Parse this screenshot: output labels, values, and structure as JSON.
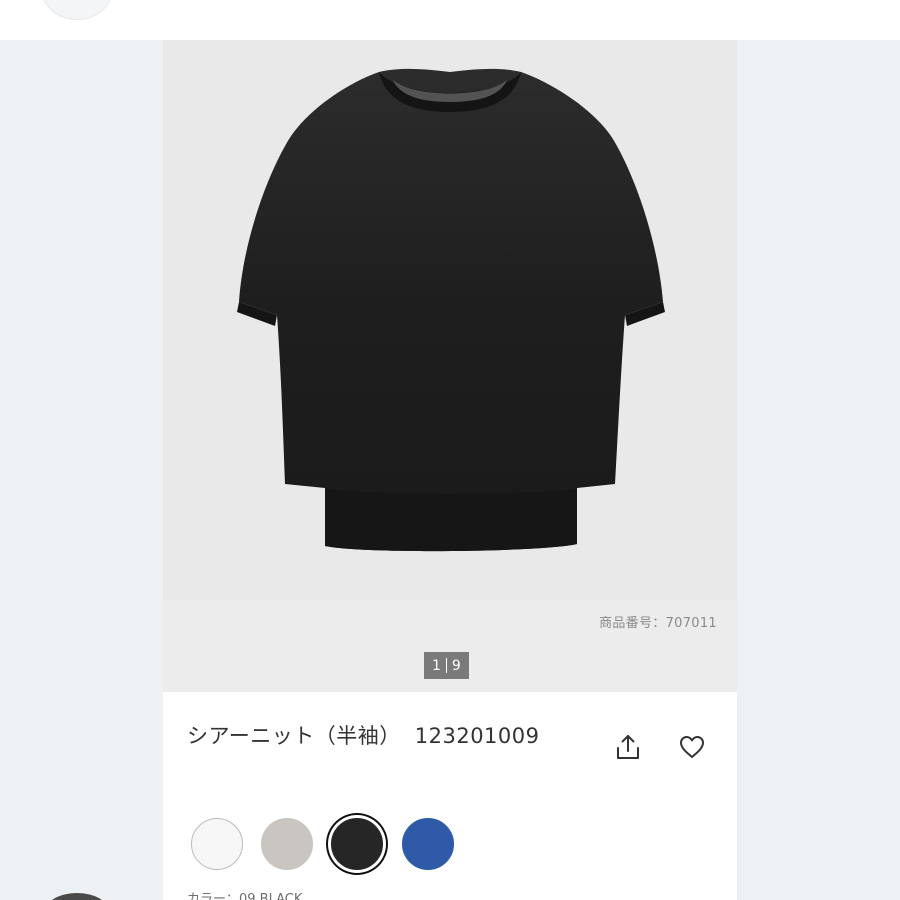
{
  "product": {
    "sku_label": "商品番号：707011",
    "pager": {
      "current": "1",
      "total": "9"
    },
    "title": "シアーニット（半袖）",
    "code": "123201009",
    "image_icon": "black-sheer-knit-short-sleeve-top",
    "actions": {
      "share_icon": "share-icon",
      "favorite_icon": "heart-icon"
    },
    "swatches": [
      {
        "name": "white",
        "color": "#f7f7f7",
        "border": "#bdbdbd",
        "selected": false
      },
      {
        "name": "light-gray",
        "color": "#c9c6c2",
        "border": "#c9c6c2",
        "selected": false
      },
      {
        "name": "black",
        "color": "#262626",
        "border": "#262626",
        "selected": true
      },
      {
        "name": "blue",
        "color": "#2f5aa8",
        "border": "#2f5aa8",
        "selected": false
      }
    ],
    "color_label": "カラー：09 BLACK"
  },
  "colors": {
    "backdrop": "#eef1f3",
    "image_bg": "#e9e9e9",
    "pager_bg": "#7a7a7a",
    "text": "#333333"
  }
}
